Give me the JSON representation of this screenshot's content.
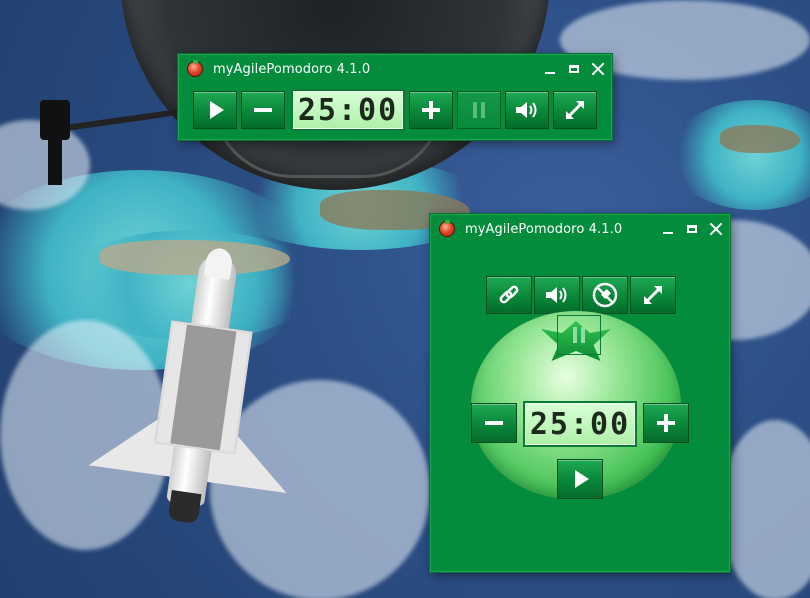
{
  "compact_window": {
    "title": "myAgilePomodoro 4.1.0",
    "timer": "25:00",
    "buttons": {
      "start": "play-icon",
      "decrease": "minus-icon",
      "increase": "plus-icon",
      "pause": "pause-icon",
      "sound": "speaker-icon",
      "expand": "expand-arrows-icon"
    }
  },
  "full_window": {
    "title": "myAgilePomodoro 4.1.0",
    "timer": "25:00",
    "top_buttons": [
      "link-icon",
      "speaker-icon",
      "pin-off-icon",
      "expand-arrows-icon"
    ],
    "buttons": {
      "decrease": "minus-icon",
      "increase": "plus-icon",
      "start": "play-icon",
      "pause": "pause-icon"
    }
  },
  "colors": {
    "window_green": "#048c3d",
    "button_green": "#0a8a3b",
    "lcd_green": "#c4f7bf",
    "tomato_green": "#3fbf53"
  }
}
